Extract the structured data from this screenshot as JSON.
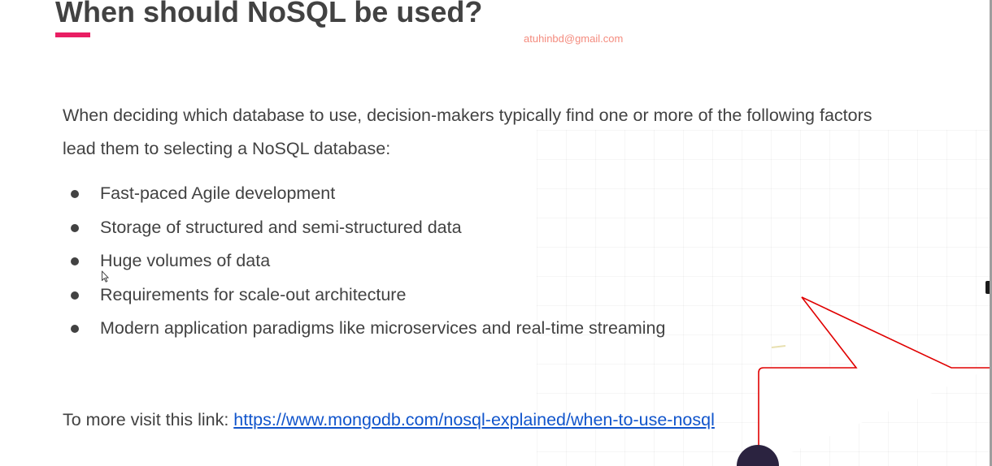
{
  "slide": {
    "title": "When should NoSQL be used?",
    "watermark": "atuhinbd@gmail.com",
    "intro": "When deciding which database to use, decision-makers typically find one or more of the following factors lead them to selecting a NoSQL database:",
    "bullets": [
      "Fast-paced Agile development",
      "Storage of structured and semi-structured data",
      "Huge volumes of data",
      "Requirements for scale-out architecture",
      "Modern application paradigms like microservices and real-time streaming"
    ],
    "link_prefix": "To more visit this link: ",
    "link_text": "https://www.mongodb.com/nosql-explained/when-to-use-nosql",
    "link_url": "https://www.mongodb.com/nosql-explained/when-to-use-nosql"
  },
  "colors": {
    "accent": "#e91e63",
    "text": "#424242",
    "link": "#1155cc",
    "watermark": "#f48b7e",
    "callout_stroke": "#e00000"
  }
}
